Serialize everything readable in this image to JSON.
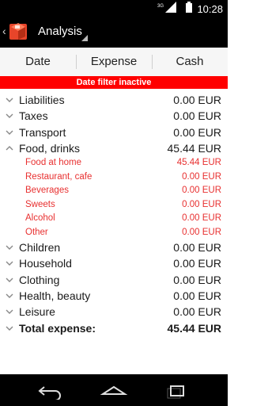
{
  "status_bar": {
    "time": "10:28",
    "network": "3G"
  },
  "action_bar": {
    "title": "Analysis"
  },
  "tabs": [
    {
      "label": "Date"
    },
    {
      "label": "Expense"
    },
    {
      "label": "Cash"
    }
  ],
  "banner": "Date filter inactive",
  "rows": [
    {
      "label": "Liabilities",
      "amount": "0.00 EUR"
    },
    {
      "label": "Taxes",
      "amount": "0.00 EUR"
    },
    {
      "label": "Transport",
      "amount": "0.00 EUR"
    },
    {
      "label": "Food, drinks",
      "amount": "45.44 EUR"
    },
    {
      "label": "Food at home",
      "amount": "45.44 EUR"
    },
    {
      "label": "Restaurant, cafe",
      "amount": "0.00 EUR"
    },
    {
      "label": "Beverages",
      "amount": "0.00 EUR"
    },
    {
      "label": "Sweets",
      "amount": "0.00 EUR"
    },
    {
      "label": "Alcohol",
      "amount": "0.00 EUR"
    },
    {
      "label": "Other",
      "amount": "0.00 EUR"
    },
    {
      "label": "Children",
      "amount": "0.00 EUR"
    },
    {
      "label": "Household",
      "amount": "0.00 EUR"
    },
    {
      "label": "Clothing",
      "amount": "0.00 EUR"
    },
    {
      "label": "Health, beauty",
      "amount": "0.00 EUR"
    },
    {
      "label": "Leisure",
      "amount": "0.00 EUR"
    },
    {
      "label": "Total expense:",
      "amount": "45.44 EUR"
    }
  ],
  "colors": {
    "accent": "#ff0000",
    "sub_item": "#e83030",
    "app_icon": "#e8452a"
  }
}
